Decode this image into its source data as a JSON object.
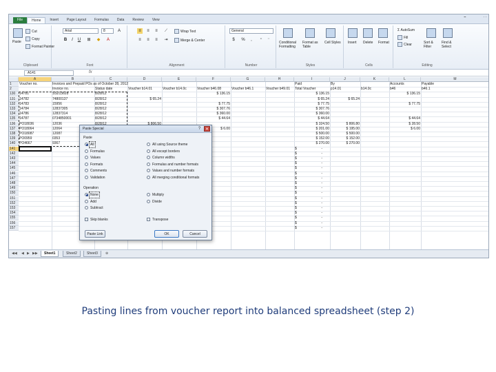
{
  "ribbon": {
    "tabs": [
      "File",
      "Home",
      "Insert",
      "Page Layout",
      "Formulas",
      "Data",
      "Review",
      "View"
    ],
    "clipboard": {
      "paste": "Paste",
      "cut": "Cut",
      "copy": "Copy",
      "format_painter": "Format Painter",
      "label": "Clipboard"
    },
    "font": {
      "name": "Arial",
      "size": "8",
      "label": "Font",
      "bold": "B",
      "italic": "I",
      "underline": "U"
    },
    "alignment": {
      "wrap": "Wrap Text",
      "merge": "Merge & Center",
      "label": "Alignment"
    },
    "number": {
      "format": "General",
      "currency": "$",
      "percent": "%",
      "comma": ",",
      "label": "Number"
    },
    "styles": {
      "conditional": "Conditional Formatting",
      "format_table": "Format as Table",
      "cell_styles": "Cell Styles",
      "label": "Styles"
    },
    "cells": {
      "insert": "Insert",
      "delete": "Delete",
      "format": "Format",
      "label": "Cells"
    },
    "editing": {
      "autosum": "AutoSum",
      "fill": "Fill",
      "clear": "Clear",
      "sort": "Sort & Filter",
      "find": "Find & Select",
      "label": "Editing"
    }
  },
  "formula_bar": {
    "name_box": "A141",
    "fx": "fx",
    "value": ""
  },
  "columns": [
    "A",
    "B",
    "C",
    "D",
    "E",
    "F",
    "G",
    "H",
    "I",
    "J",
    "K",
    "L",
    "M"
  ],
  "header_rows": [
    {
      "row": "1",
      "A": "Voucher no.",
      "B": "Invoices and Prepaid POs as of October 28, 2012",
      "I": "Paid",
      "J": "By",
      "L": "Accounts",
      "M": "Payable"
    },
    {
      "row": "2",
      "B": "Invoice no.",
      "C": "Status date",
      "D": "Voucher b14.01",
      "E": "Voucher b14.0c",
      "F": "Voucher b46.08",
      "G": "Voucher b46.1",
      "H": "Voucher b49.01",
      "I": "Total Voucher",
      "J": "p14.01",
      "K": "b14.0c",
      "L": "b46",
      "M": "b46.1"
    }
  ],
  "data_rows": [
    {
      "row": "130",
      "A": "14781",
      "B": "SS213628",
      "C": "8/28/12",
      "F": "$  136.15",
      "I": "$  136.15",
      "L": "$  136.15"
    },
    {
      "row": "131",
      "A": "14782",
      "B": "74800137",
      "C": "8/28/12",
      "D": "$  65.24",
      "I": "$  65.24",
      "J": "$  65.24"
    },
    {
      "row": "132",
      "A": "14783",
      "B": "15956",
      "C": "8/28/12",
      "F": "$  77.75",
      "I": "$  77.75",
      "L": "$  77.75"
    },
    {
      "row": "133",
      "A": "14784",
      "B": "12837305",
      "C": "8/28/12",
      "F": "$  307.76",
      "I": "$  307.76"
    },
    {
      "row": "134",
      "A": "14786",
      "B": "12837314",
      "C": "8/28/12",
      "F": "$  360.00",
      "I": "$  360.00"
    },
    {
      "row": "135",
      "A": "14787",
      "B": "0734850001",
      "C": "8/28/12",
      "F": "$  44.64",
      "I": "$  44.64",
      "L": "$  44.64"
    },
    {
      "row": "136",
      "A": "PO18036",
      "B": "12036",
      "C": "8/28/12",
      "D": "$  806.50",
      "I": "$  324.50",
      "J": "$  806.80",
      "L": "$  28.50"
    },
    {
      "row": "137",
      "A": "PO18064",
      "B": "12064",
      "C": "8/28/12",
      "F": "$  6.00",
      "I": "$  201.00",
      "J": "$  195.00",
      "L": "$  6.00"
    },
    {
      "row": "138",
      "A": "PO18087",
      "B": "12087",
      "C": "8/28/12",
      "I": "$  500.00",
      "J": "$  500.00"
    },
    {
      "row": "139",
      "A": "PO0959",
      "B": "0353",
      "C": "8/28/12",
      "I": "$  152.00",
      "J": "$  152.00"
    },
    {
      "row": "140",
      "A": "PO4667",
      "B": "9367",
      "C": "8/28/12",
      "I": "$  270.00",
      "J": "$  270.00"
    }
  ],
  "empty_rows": [
    "141",
    "142",
    "143",
    "144",
    "145",
    "146",
    "147",
    "148",
    "149",
    "150",
    "151",
    "152",
    "153",
    "154",
    "155",
    "156",
    "157"
  ],
  "empty_totals": {
    "dollar": "$",
    "dash": "-"
  },
  "sheets": [
    "Sheet1",
    "Sheet2",
    "Sheet3"
  ],
  "dialog": {
    "title": "Paste Special",
    "paste_label": "Paste",
    "paste_left": [
      "All",
      "Formulas",
      "Values",
      "Formats",
      "Comments",
      "Validation"
    ],
    "paste_right": [
      "All using Source theme",
      "All except borders",
      "Column widths",
      "Formulas and number formats",
      "Values and number formats",
      "All merging conditional formats"
    ],
    "operation_label": "Operation",
    "op_left": [
      "None",
      "Add",
      "Subtract"
    ],
    "op_right": [
      "Multiply",
      "Divide"
    ],
    "skip_blanks": "Skip blanks",
    "transpose": "Transpose",
    "paste_link": "Paste Link",
    "ok": "OK",
    "cancel": "Cancel"
  },
  "caption": "Pasting lines from voucher report into balanced spreadsheet (step 2)"
}
